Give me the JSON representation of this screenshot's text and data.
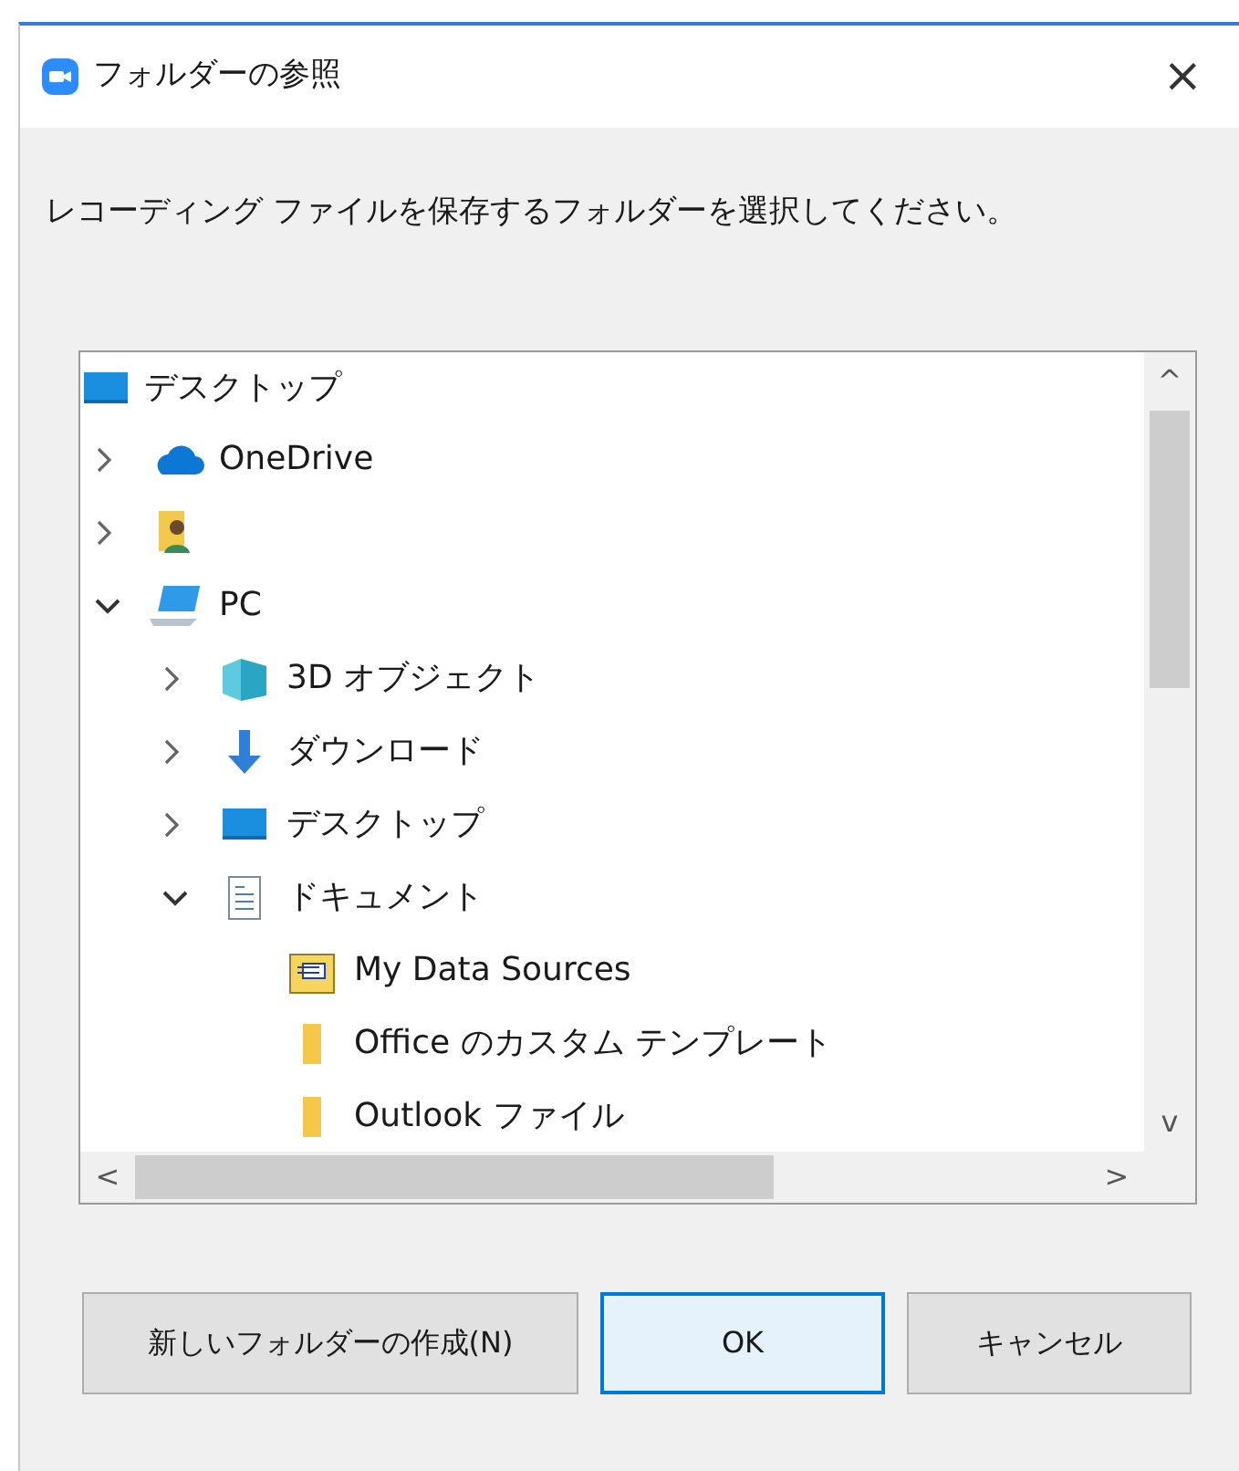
{
  "window": {
    "title": "フォルダーの参照",
    "close": "×"
  },
  "message": "レコーディング ファイルを保存するフォルダーを選択してください。",
  "tree": {
    "root": {
      "label": "デスクトップ",
      "kind": "desktop",
      "children": [
        {
          "label": "OneDrive",
          "kind": "cloud",
          "expanded": false
        },
        {
          "kind": "user",
          "expanded": false
        },
        {
          "label": "PC",
          "kind": "pc",
          "expanded": true,
          "children": [
            {
              "label": "3D オブジェクト",
              "kind": "cube",
              "expanded": false
            },
            {
              "label": "ダウンロード",
              "kind": "download",
              "expanded": false
            },
            {
              "label": "デスクトップ",
              "kind": "desktop",
              "expanded": false
            },
            {
              "label": "ドキュメント",
              "kind": "documents",
              "expanded": true,
              "children": [
                {
                  "label": "My Data Sources",
                  "kind": "datasource"
                },
                {
                  "label": "Office のカスタム テンプレート",
                  "kind": "folder"
                },
                {
                  "label": "Outlook ファイル",
                  "kind": "folder"
                }
              ]
            }
          ]
        }
      ]
    },
    "scroll_up": "^",
    "scroll_down": "v",
    "scroll_left": "<",
    "scroll_right": ">"
  },
  "buttons": [
    {
      "label": "新しいフォルダーの作成(N)",
      "kind": "normal"
    },
    {
      "label": "OK",
      "kind": "default"
    },
    {
      "label": "キャンセル",
      "kind": "normal"
    }
  ]
}
